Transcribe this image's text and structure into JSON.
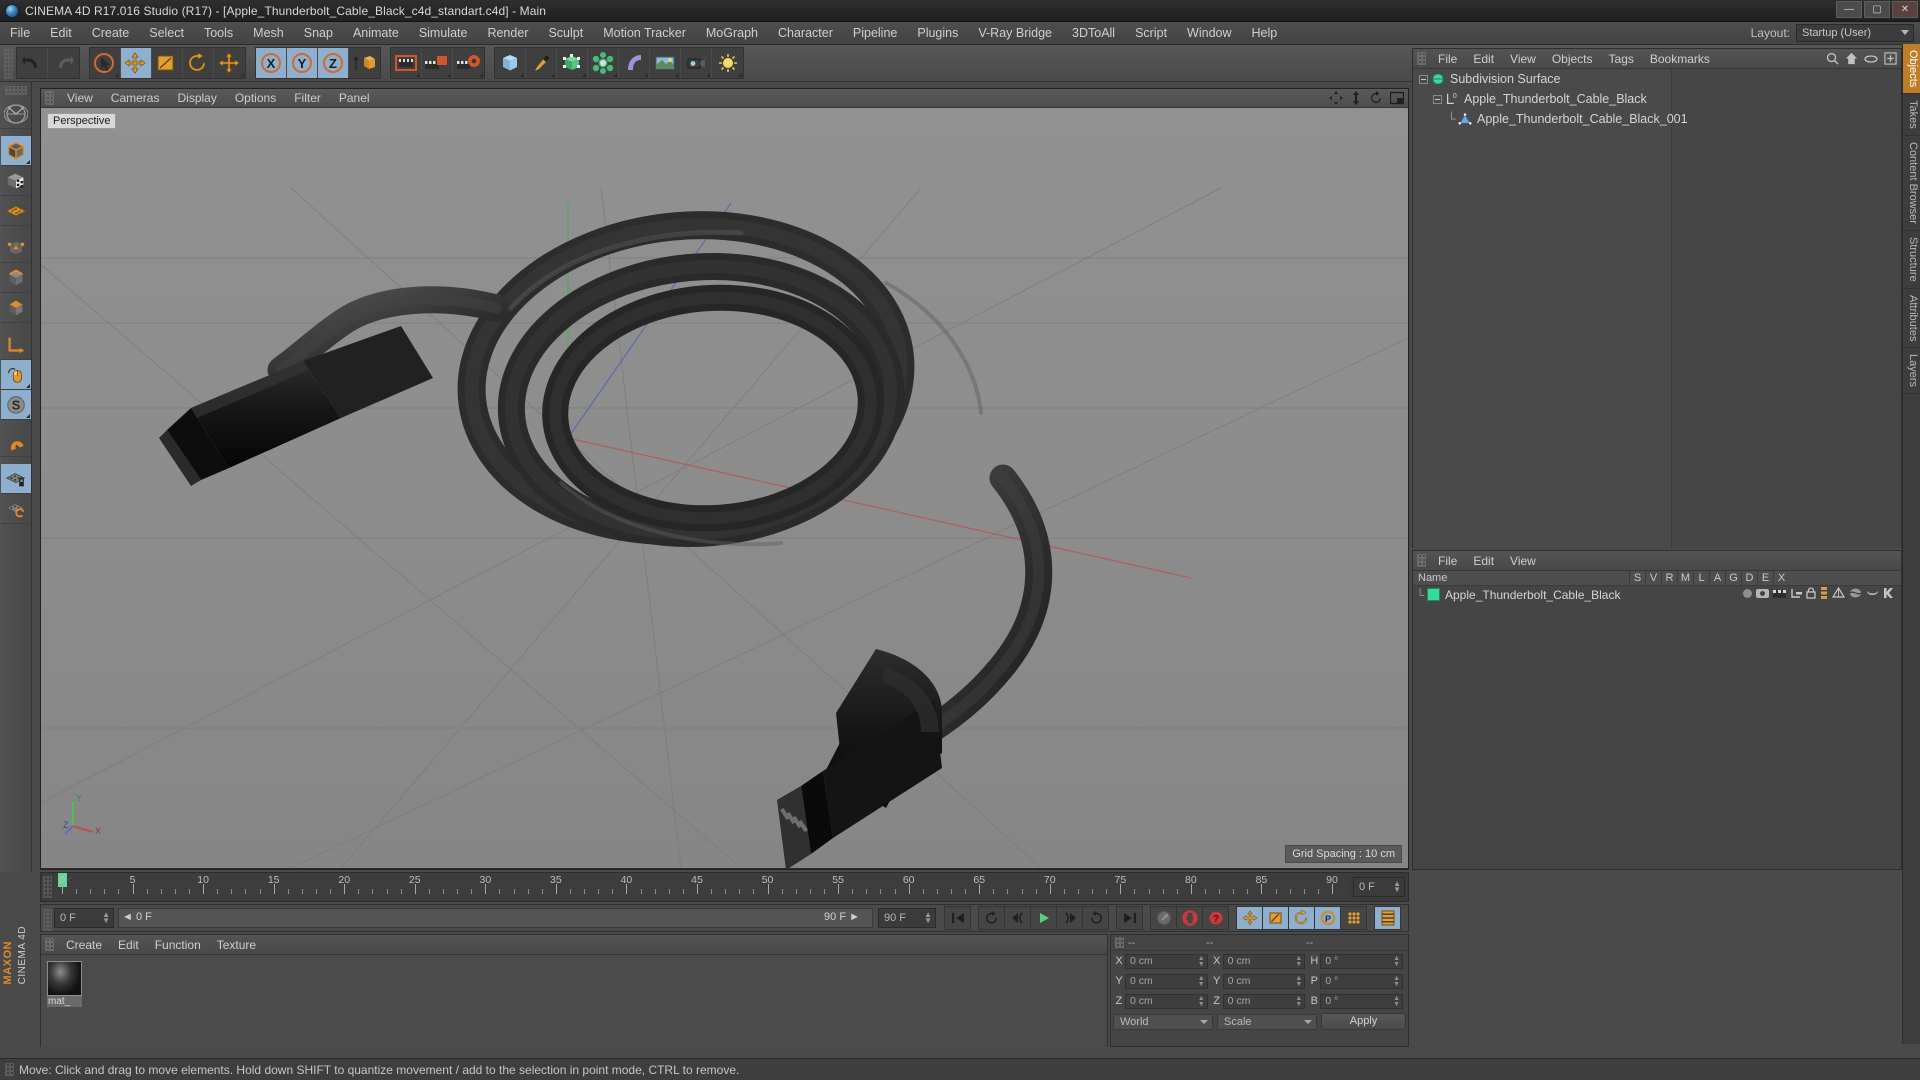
{
  "window": {
    "title": "CINEMA 4D R17.016 Studio (R17) - [Apple_Thunderbolt_Cable_Black_c4d_standart.c4d] - Main",
    "app_icon": "c4d-logo-icon",
    "minimize": "—",
    "maximize": "▢",
    "close": "✕"
  },
  "menubar": {
    "items": [
      "File",
      "Edit",
      "Create",
      "Select",
      "Tools",
      "Mesh",
      "Snap",
      "Animate",
      "Simulate",
      "Render",
      "Sculpt",
      "Motion Tracker",
      "MoGraph",
      "Character",
      "Pipeline",
      "Plugins",
      "V-Ray Bridge",
      "3DToAll",
      "Script",
      "Window",
      "Help"
    ],
    "layout_label": "Layout:",
    "layout_value": "Startup (User)"
  },
  "toolbar": {
    "groups": [
      {
        "name": "history",
        "buttons": [
          {
            "name": "undo-icon",
            "label": "Undo",
            "active": false
          },
          {
            "name": "redo-icon",
            "label": "Redo",
            "active": false
          }
        ]
      },
      {
        "name": "transform",
        "buttons": [
          {
            "name": "select-live-icon",
            "label": "Live Selection",
            "active": false
          },
          {
            "name": "move-icon",
            "label": "Move",
            "active": true
          },
          {
            "name": "scale-icon",
            "label": "Scale",
            "active": false
          },
          {
            "name": "rotate-icon",
            "label": "Rotate",
            "active": false
          },
          {
            "name": "move-dynamic-icon",
            "label": "Dynamic Place",
            "active": false
          }
        ]
      },
      {
        "name": "axis-locks",
        "buttons": [
          {
            "name": "axis-x-icon",
            "label": "X",
            "active": true
          },
          {
            "name": "axis-y-icon",
            "label": "Y",
            "active": true
          },
          {
            "name": "axis-z-icon",
            "label": "Z",
            "active": true
          },
          {
            "name": "world-object-axis-icon",
            "label": "World/Object",
            "active": false
          }
        ]
      },
      {
        "name": "render",
        "buttons": [
          {
            "name": "render-view-icon",
            "label": "Render View",
            "active": false
          },
          {
            "name": "render-to-picture-viewer-icon",
            "label": "Render to Picture Viewer",
            "active": false
          },
          {
            "name": "render-settings-icon",
            "label": "Edit Render Settings",
            "active": false
          }
        ]
      },
      {
        "name": "create",
        "buttons": [
          {
            "name": "cube-primitive-icon",
            "label": "Add Cube Object",
            "active": false
          },
          {
            "name": "pen-spline-icon",
            "label": "Add Spline",
            "active": false
          },
          {
            "name": "nurbs-icon",
            "label": "Add Generator",
            "active": false
          },
          {
            "name": "array-icon",
            "label": "Add Array",
            "active": false
          },
          {
            "name": "bend-deformer-icon",
            "label": "Add Bend",
            "active": false
          },
          {
            "name": "environment-icon",
            "label": "Add Environment",
            "active": false
          },
          {
            "name": "camera-icon",
            "label": "Add Camera",
            "active": false
          },
          {
            "name": "light-icon",
            "label": "Add Light",
            "active": false
          }
        ]
      }
    ]
  },
  "lefttoolbar": {
    "buttons": [
      {
        "name": "make-editable-icon",
        "label": "Make Editable",
        "active": false
      },
      {
        "name": "model-mode-icon",
        "label": "Model Mode",
        "active": true
      },
      {
        "name": "texture-mode-icon",
        "label": "Texture Mode",
        "active": false
      },
      {
        "name": "grid-plane-icon",
        "label": "Workplane",
        "active": false
      },
      {
        "name": "point-mode-icon",
        "label": "Points",
        "active": false
      },
      {
        "name": "edge-mode-icon",
        "label": "Edges",
        "active": false
      },
      {
        "name": "polygon-mode-icon",
        "label": "Polygons",
        "active": false
      },
      {
        "name": "axis-modify-icon",
        "label": "Enable Axis",
        "active": false
      },
      {
        "name": "viewport-solo-icon",
        "label": "Viewport Solo",
        "active": true
      },
      {
        "name": "soft-selection-icon",
        "label": "Soft Selection",
        "active": true
      },
      {
        "name": "lock-workplane-icon",
        "label": "Lock Workplane",
        "active": true
      },
      {
        "name": "planar-workplane-icon",
        "label": "Planar Workplane",
        "active": false
      }
    ]
  },
  "viewport": {
    "menu": [
      "View",
      "Cameras",
      "Display",
      "Options",
      "Filter",
      "Panel"
    ],
    "camera_label": "Perspective",
    "grid_spacing": "Grid Spacing : 10 cm",
    "corner_icons": [
      "pan-view-icon",
      "dolly-view-icon",
      "rotate-view-icon",
      "maximize-view-icon"
    ],
    "axis_gizmo": {
      "x": "X",
      "y": "Y",
      "z": "Z"
    }
  },
  "object_manager": {
    "menu": [
      "File",
      "Edit",
      "View",
      "Objects",
      "Tags",
      "Bookmarks"
    ],
    "tools": [
      "search-icon",
      "home-icon",
      "ellipse-icon",
      "add-layer-icon"
    ],
    "rows": [
      {
        "name": "Subdivision Surface",
        "icon": "subdivision-surface-icon",
        "depth": 0,
        "expander": "minus",
        "chip": "gray",
        "check": "✔"
      },
      {
        "name": "Apple_Thunderbolt_Cable_Black",
        "icon": "null-object-icon",
        "depth": 1,
        "expander": "minus",
        "chip": "green",
        "check": ""
      },
      {
        "name": "Apple_Thunderbolt_Cable_Black_001",
        "icon": "polygon-object-icon",
        "depth": 2,
        "expander": "none",
        "chip": "green",
        "check": ""
      }
    ],
    "tags": [
      "material-tag-icon",
      "texture-tag-icon",
      "uvw-tag-icon"
    ]
  },
  "attribute_manager": {
    "menu": [
      "File",
      "Edit",
      "View"
    ],
    "name_column": "Name",
    "columns": [
      "S",
      "V",
      "R",
      "M",
      "L",
      "A",
      "G",
      "D",
      "E",
      "X"
    ],
    "rows": [
      {
        "name": "Apple_Thunderbolt_Cable_Black",
        "chip": "green"
      }
    ]
  },
  "dock_tabs": [
    {
      "label": "Objects",
      "active": true
    },
    {
      "label": "Takes",
      "active": false
    },
    {
      "label": "Content Browser",
      "active": false
    },
    {
      "label": "Structure",
      "active": false
    },
    {
      "label": "Attributes",
      "active": false
    },
    {
      "label": "Layers",
      "active": false
    }
  ],
  "timeline": {
    "start_frame": "0 F",
    "current_frame_field": "0 F",
    "range_start": "0 F",
    "range_end": "90 F",
    "end_field": "90 F",
    "ticks": [
      0,
      5,
      10,
      15,
      20,
      25,
      30,
      35,
      40,
      45,
      50,
      55,
      60,
      65,
      70,
      75,
      80,
      85,
      90
    ],
    "min": 0,
    "max": 90,
    "playhead": 0
  },
  "transport": {
    "buttons": [
      {
        "name": "goto-start-icon",
        "label": "Go to Start",
        "active": false
      },
      {
        "name": "prev-keyframe-icon",
        "label": "Go to Previous Key",
        "active": false
      },
      {
        "name": "prev-frame-icon",
        "label": "Go to Previous Frame",
        "active": false
      },
      {
        "name": "play-icon",
        "label": "Play Forwards",
        "active": false
      },
      {
        "name": "next-frame-icon",
        "label": "Go to Next Frame",
        "active": false
      },
      {
        "name": "next-keyframe-icon",
        "label": "Go to Next Key",
        "active": false
      },
      {
        "name": "goto-end-icon",
        "label": "Go to End",
        "active": false
      }
    ],
    "record_group": [
      {
        "name": "autokey-icon",
        "label": "Autokeying",
        "active": false
      },
      {
        "name": "record-active-objects-icon",
        "label": "Record Active Objects",
        "active": false
      },
      {
        "name": "keyframe-selection-icon",
        "label": "Keyframe Selection",
        "active": false
      }
    ],
    "channels": [
      {
        "name": "position-key-icon",
        "label": "Position",
        "active": true
      },
      {
        "name": "scale-key-icon",
        "label": "Scale",
        "active": true
      },
      {
        "name": "rotation-key-icon",
        "label": "Rotation",
        "active": true
      },
      {
        "name": "parameter-key-icon",
        "label": "Parameter",
        "active": true
      },
      {
        "name": "point-level-anim-icon",
        "label": "Point Level Animation",
        "active": false
      },
      {
        "name": "timeline-toggle-icon",
        "label": "Timeline",
        "active": true
      }
    ]
  },
  "material_manager": {
    "menu": [
      "Create",
      "Edit",
      "Function",
      "Texture"
    ],
    "materials": [
      {
        "name": "mat_",
        "swatch": "black-glossy-sphere-icon"
      }
    ]
  },
  "coordinates": {
    "headers": [
      "--",
      "--",
      "--"
    ],
    "rows": [
      {
        "labels": [
          "X",
          "X",
          "H"
        ],
        "values": [
          "0 cm",
          "0 cm",
          "0 °"
        ]
      },
      {
        "labels": [
          "Y",
          "Y",
          "P"
        ],
        "values": [
          "0 cm",
          "0 cm",
          "0 °"
        ]
      },
      {
        "labels": [
          "Z",
          "Z",
          "B"
        ],
        "values": [
          "0 cm",
          "0 cm",
          "0 °"
        ]
      }
    ],
    "system": "World",
    "mode": "Scale",
    "apply": "Apply"
  },
  "statusbar": {
    "message": "Move: Click and drag to move elements. Hold down SHIFT to quantize movement / add to the selection in point mode, CTRL to remove."
  },
  "branding": {
    "line1": "MAXON",
    "line2": "CINEMA 4D"
  },
  "colors": {
    "accent_orange": "#e08a2a",
    "active_blue": "#8fafcf",
    "green_chip": "#39d99a",
    "play_green": "#5fd89a",
    "red": "#c8383c",
    "panel_bg": "#4a4a4a"
  }
}
